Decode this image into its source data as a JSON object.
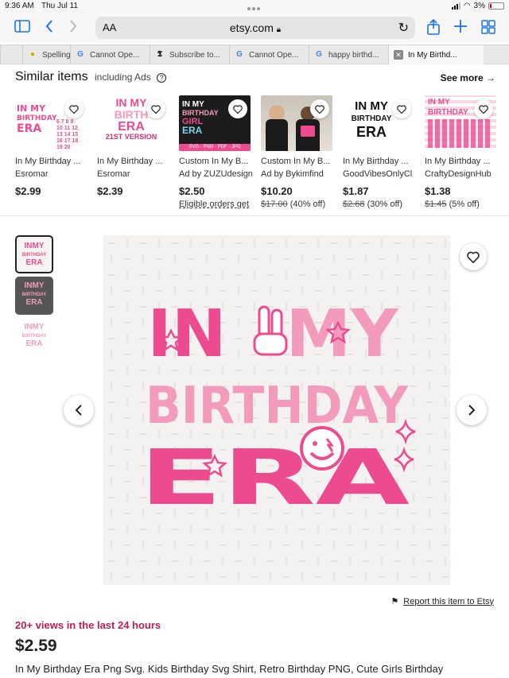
{
  "status": {
    "time": "9:36 AM",
    "date": "Thu Jul 11",
    "battery": "3%"
  },
  "browser": {
    "aa_label": "AA",
    "host": "etsy.com",
    "tabs": [
      {
        "label": "",
        "icon": "tab-icon"
      },
      {
        "label": "Spelling",
        "icon": "bee-icon"
      },
      {
        "label": "Cannot Ope...",
        "icon": "google-icon"
      },
      {
        "label": "Subscribe to...",
        "icon": "nyt-icon"
      },
      {
        "label": "Cannot Ope...",
        "icon": "google-icon"
      },
      {
        "label": "happy birthd...",
        "icon": "google-icon"
      },
      {
        "label": "In My Birthd...",
        "icon": "close-icon"
      }
    ]
  },
  "similar": {
    "title": "Similar items",
    "subtitle": "including Ads",
    "see_more": "See more",
    "items": [
      {
        "title": "In My Birthday ...",
        "shop": "Esromar",
        "price": "$2.99",
        "orig": "",
        "discount": "",
        "note": ""
      },
      {
        "title": "In My Birthday ...",
        "shop": "Esromar",
        "price": "$2.39",
        "orig": "",
        "discount": "",
        "note": ""
      },
      {
        "title": "Custom In My B...",
        "shop": "Ad by ZUZUdesigns",
        "price": "$2.50",
        "orig": "",
        "discount": "",
        "note": "Eligible orders get"
      },
      {
        "title": "Custom In My B...",
        "shop": "Ad by Bykimfind",
        "price": "$10.20",
        "orig": "$17.00",
        "discount": "(40% off)",
        "note": ""
      },
      {
        "title": "In My Birthday ...",
        "shop": "GoodVibesOnlyCl",
        "price": "$1.87",
        "orig": "$2.68",
        "discount": "(30% off)",
        "note": ""
      },
      {
        "title": "In My Birthday ...",
        "shop": "CraftyDesignHub",
        "price": "$1.38",
        "orig": "$1.45",
        "discount": "(5% off)",
        "note": ""
      }
    ],
    "thumb_texts": {
      "t1": [
        "IN MY",
        "BIRTHDAY",
        "ERA"
      ],
      "t2": [
        "IN MY",
        "BIRTH",
        "ERA",
        "21ST VERSION"
      ],
      "t3": [
        "IN MY",
        "BIRTHDAY",
        "GIRL",
        "ERA",
        "SVG · PNG · PDF · JPG"
      ],
      "t5": [
        "IN MY",
        "BIRTHDAY",
        "ERA"
      ],
      "t6": [
        "IN MY",
        "BIRTHDAY"
      ]
    }
  },
  "gallery": {
    "image_lines": [
      "IN",
      "MY",
      "BIRTHDAY",
      "ERA"
    ]
  },
  "product": {
    "report": "Report this item to Etsy",
    "views": "20+ views in the last 24 hours",
    "price": "$2.59",
    "title": "In My Birthday Era Png Svg. Kids Birthday Svg Shirt, Retro Birthday PNG, Cute Girls Birthday"
  },
  "colors": {
    "pink": "#ec4b8f",
    "light_pink": "#f29bbd",
    "views": "#c21a5a"
  }
}
